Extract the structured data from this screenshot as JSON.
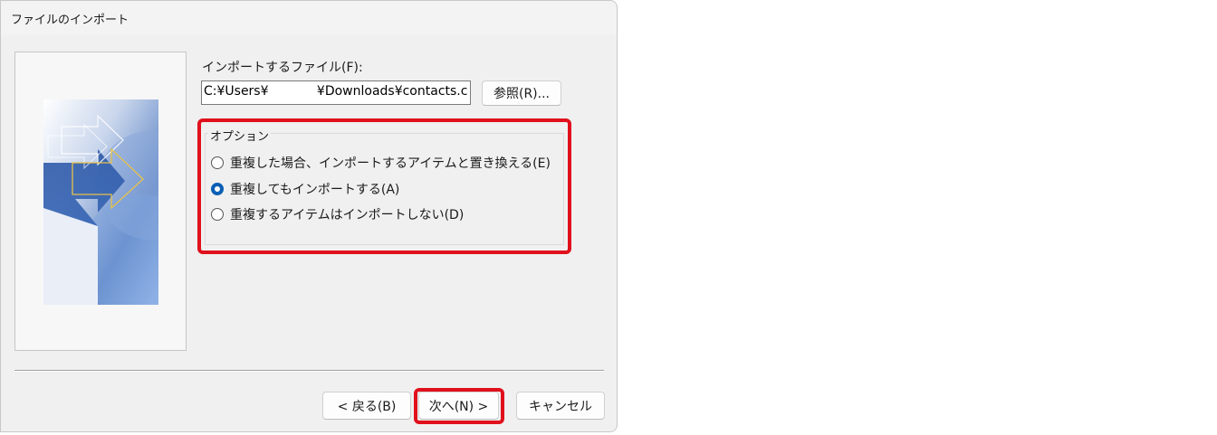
{
  "window": {
    "title": "ファイルのインポート"
  },
  "file": {
    "label": "インポートするファイル(F):",
    "path_value": "C:¥Users¥            ¥Downloads¥contacts.c",
    "browse_label": "参照(R)..."
  },
  "options": {
    "legend": "オプション",
    "items": [
      {
        "label": "重複した場合、インポートするアイテムと置き換える(E)",
        "checked": false
      },
      {
        "label": "重複してもインポートする(A)",
        "checked": true
      },
      {
        "label": "重複するアイテムはインポートしない(D)",
        "checked": false
      }
    ]
  },
  "footer": {
    "back_label": "< 戻る(B)",
    "next_label": "次へ(N) >",
    "cancel_label": "キャンセル"
  },
  "colors": {
    "highlight": "#e0101c",
    "accent": "#0a5fb4"
  }
}
